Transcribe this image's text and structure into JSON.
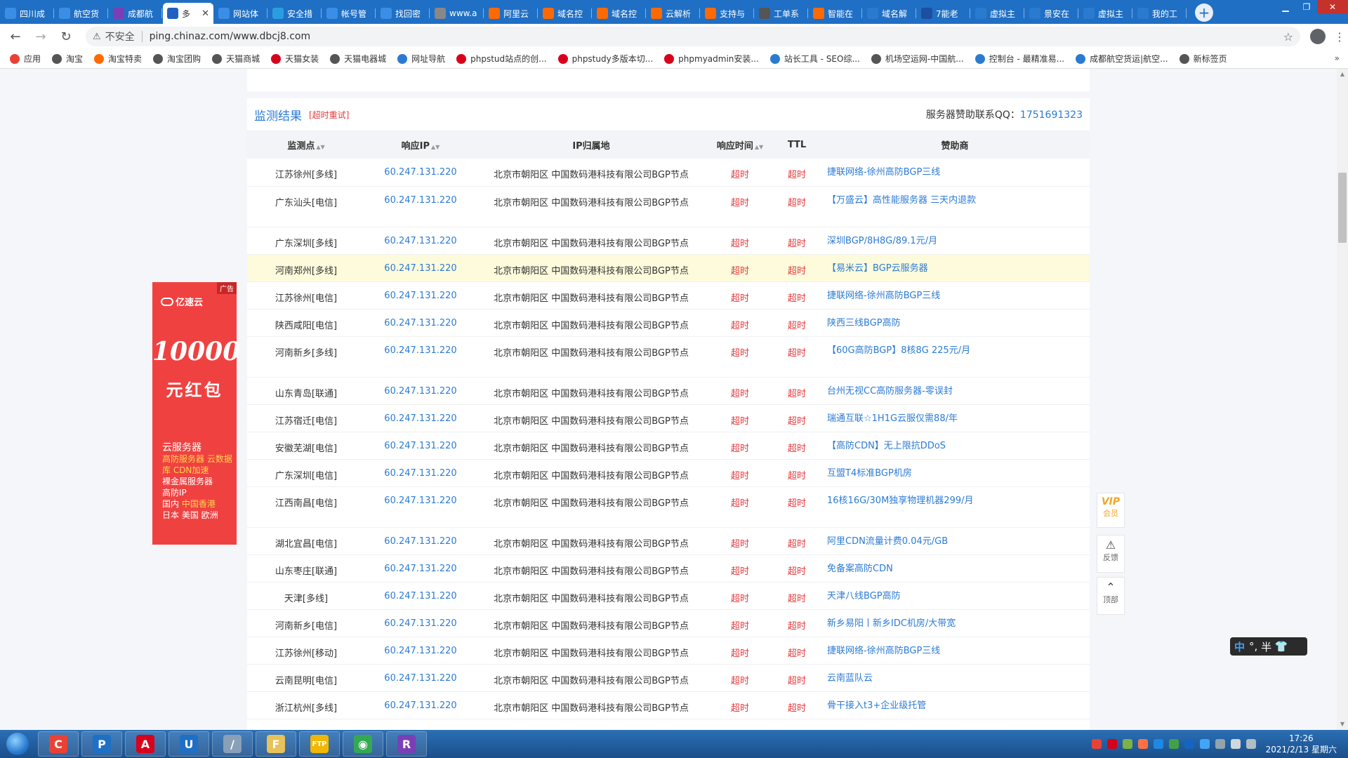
{
  "browser": {
    "tabs": [
      {
        "title": "四川成",
        "color": "#3a8ee6"
      },
      {
        "title": "航空货",
        "color": "#3a8ee6"
      },
      {
        "title": "成都航",
        "color": "#7b3fb5"
      },
      {
        "title": "多",
        "color": "#2060c0",
        "active": true
      },
      {
        "title": "网站体",
        "color": "#3a8ee6"
      },
      {
        "title": "安全措",
        "color": "#2a9de0"
      },
      {
        "title": "帐号管",
        "color": "#3a8ee6"
      },
      {
        "title": "找回密",
        "color": "#3a8ee6"
      },
      {
        "title": "www.a",
        "color": "#888888"
      },
      {
        "title": "阿里云",
        "color": "#ff6a00"
      },
      {
        "title": "域名控",
        "color": "#ff6a00"
      },
      {
        "title": "域名控",
        "color": "#ff6a00"
      },
      {
        "title": "云解析",
        "color": "#ff6a00"
      },
      {
        "title": "支持与",
        "color": "#ff6a00"
      },
      {
        "title": "工单系",
        "color": "#555555"
      },
      {
        "title": "智能在",
        "color": "#ff6a00"
      },
      {
        "title": "域名解",
        "color": "#2a7bd0"
      },
      {
        "title": "7能老",
        "color": "#1c4fa0"
      },
      {
        "title": "虚拟主",
        "color": "#2a7bd0"
      },
      {
        "title": "景安在",
        "color": "#2a7bd0"
      },
      {
        "title": "虚拟主",
        "color": "#2a7bd0"
      },
      {
        "title": "我的工",
        "color": "#2a7bd0"
      }
    ],
    "close_glyph": "✕",
    "new_tab": "+",
    "url_insecure": "不安全",
    "url": "ping.chinaz.com/www.dbcj8.com",
    "bookmarks": [
      {
        "label": "应用",
        "color": "#e94235"
      },
      {
        "label": "淘宝",
        "color": "#555555"
      },
      {
        "label": "淘宝特卖",
        "color": "#ff6a00"
      },
      {
        "label": "淘宝团购",
        "color": "#555555"
      },
      {
        "label": "天猫商城",
        "color": "#555555"
      },
      {
        "label": "天猫女装",
        "color": "#d9001b"
      },
      {
        "label": "天猫电器城",
        "color": "#555555"
      },
      {
        "label": "网址导航",
        "color": "#2a7bd0"
      },
      {
        "label": "phpstud站点的创...",
        "color": "#d9001b"
      },
      {
        "label": "phpstudy多版本切...",
        "color": "#d9001b"
      },
      {
        "label": "phpmyadmin安装...",
        "color": "#d9001b"
      },
      {
        "label": "站长工具 - SEO综...",
        "color": "#2a7bd0"
      },
      {
        "label": "机场空运网-中国航...",
        "color": "#555555"
      },
      {
        "label": "控制台 - 最精准易...",
        "color": "#2a7bd0"
      },
      {
        "label": "成都航空货运|航空...",
        "color": "#2a7bd0"
      },
      {
        "label": "新标签页",
        "color": "#555555"
      }
    ],
    "bookmarks_more": "»"
  },
  "panel": {
    "title": "监测结果",
    "retry": "[超时重试]",
    "sponsor_label": "服务器赞助联系QQ：",
    "sponsor_qq": "1751691323"
  },
  "table": {
    "headers": [
      "监测点",
      "响应IP",
      "IP归属地",
      "响应时间",
      "TTL",
      "赞助商"
    ],
    "rows": [
      {
        "node": "江苏徐州[多线]",
        "ip": "60.247.131.220",
        "loc": "北京市朝阳区 中国数码港科技有限公司BGP节点",
        "time": "超时",
        "ttl": "超时",
        "sponsor": "捷联网络-徐州高防BGP三线",
        "tall": false
      },
      {
        "node": "广东汕头[电信]",
        "ip": "60.247.131.220",
        "loc": "北京市朝阳区 中国数码港科技有限公司BGP节点",
        "time": "超时",
        "ttl": "超时",
        "sponsor": "【万盛云】高性能服务器 三天内退款",
        "tall": true
      },
      {
        "node": "广东深圳[多线]",
        "ip": "60.247.131.220",
        "loc": "北京市朝阳区 中国数码港科技有限公司BGP节点",
        "time": "超时",
        "ttl": "超时",
        "sponsor": "深圳BGP/8H8G/89.1元/月",
        "tall": false
      },
      {
        "node": "河南郑州[多线]",
        "ip": "60.247.131.220",
        "loc": "北京市朝阳区 中国数码港科技有限公司BGP节点",
        "time": "超时",
        "ttl": "超时",
        "sponsor": "【易米云】BGP云服务器",
        "tall": false,
        "highlight": true
      },
      {
        "node": "江苏徐州[电信]",
        "ip": "60.247.131.220",
        "loc": "北京市朝阳区 中国数码港科技有限公司BGP节点",
        "time": "超时",
        "ttl": "超时",
        "sponsor": "捷联网络-徐州高防BGP三线",
        "tall": false
      },
      {
        "node": "陕西咸阳[电信]",
        "ip": "60.247.131.220",
        "loc": "北京市朝阳区 中国数码港科技有限公司BGP节点",
        "time": "超时",
        "ttl": "超时",
        "sponsor": "陕西三线BGP高防",
        "tall": false
      },
      {
        "node": "河南新乡[多线]",
        "ip": "60.247.131.220",
        "loc": "北京市朝阳区 中国数码港科技有限公司BGP节点",
        "time": "超时",
        "ttl": "超时",
        "sponsor": "【60G高防BGP】8核8G 225元/月",
        "tall": true
      },
      {
        "node": "山东青岛[联通]",
        "ip": "60.247.131.220",
        "loc": "北京市朝阳区 中国数码港科技有限公司BGP节点",
        "time": "超时",
        "ttl": "超时",
        "sponsor": "台州无视CC高防服务器-零误封",
        "tall": false
      },
      {
        "node": "江苏宿迁[电信]",
        "ip": "60.247.131.220",
        "loc": "北京市朝阳区 中国数码港科技有限公司BGP节点",
        "time": "超时",
        "ttl": "超时",
        "sponsor": "瑞通互联☆1H1G云服仅需88/年",
        "tall": false
      },
      {
        "node": "安徽芜湖[电信]",
        "ip": "60.247.131.220",
        "loc": "北京市朝阳区 中国数码港科技有限公司BGP节点",
        "time": "超时",
        "ttl": "超时",
        "sponsor": "【高防CDN】无上限抗DDoS",
        "tall": false
      },
      {
        "node": "广东深圳[电信]",
        "ip": "60.247.131.220",
        "loc": "北京市朝阳区 中国数码港科技有限公司BGP节点",
        "time": "超时",
        "ttl": "超时",
        "sponsor": "互盟T4标准BGP机房",
        "tall": false
      },
      {
        "node": "江西南昌[电信]",
        "ip": "60.247.131.220",
        "loc": "北京市朝阳区 中国数码港科技有限公司BGP节点",
        "time": "超时",
        "ttl": "超时",
        "sponsor": "16核16G/30M独享物理机器299/月",
        "tall": true
      },
      {
        "node": "湖北宜昌[电信]",
        "ip": "60.247.131.220",
        "loc": "北京市朝阳区 中国数码港科技有限公司BGP节点",
        "time": "超时",
        "ttl": "超时",
        "sponsor": "阿里CDN流量计费0.04元/GB",
        "tall": false
      },
      {
        "node": "山东枣庄[联通]",
        "ip": "60.247.131.220",
        "loc": "北京市朝阳区 中国数码港科技有限公司BGP节点",
        "time": "超时",
        "ttl": "超时",
        "sponsor": "免备案高防CDN",
        "tall": false
      },
      {
        "node": "天津[多线]",
        "ip": "60.247.131.220",
        "loc": "北京市朝阳区 中国数码港科技有限公司BGP节点",
        "time": "超时",
        "ttl": "超时",
        "sponsor": "天津八线BGP高防",
        "tall": false
      },
      {
        "node": "河南新乡[电信]",
        "ip": "60.247.131.220",
        "loc": "北京市朝阳区 中国数码港科技有限公司BGP节点",
        "time": "超时",
        "ttl": "超时",
        "sponsor": "新乡易阳丨新乡IDC机房/大带宽",
        "tall": false
      },
      {
        "node": "江苏徐州[移动]",
        "ip": "60.247.131.220",
        "loc": "北京市朝阳区 中国数码港科技有限公司BGP节点",
        "time": "超时",
        "ttl": "超时",
        "sponsor": "捷联网络-徐州高防BGP三线",
        "tall": false
      },
      {
        "node": "云南昆明[电信]",
        "ip": "60.247.131.220",
        "loc": "北京市朝阳区 中国数码港科技有限公司BGP节点",
        "time": "超时",
        "ttl": "超时",
        "sponsor": "云南蓝队云",
        "tall": false
      },
      {
        "node": "浙江杭州[多线]",
        "ip": "60.247.131.220",
        "loc": "北京市朝阳区 中国数码港科技有限公司BGP节点",
        "time": "超时",
        "ttl": "超时",
        "sponsor": "骨干接入t3+企业级托管",
        "tall": false
      }
    ]
  },
  "ad": {
    "tag": "广告",
    "brand": "亿速云",
    "headline": "10000",
    "subline": "元红包",
    "line1": "云服务器",
    "line2": "高防服务器 云数据库 CDN加速",
    "line3": "裸金属服务器",
    "line4": "高防IP",
    "line5a": "国内",
    "line5b": "中国香港",
    "line6": "日本 美国 欧洲"
  },
  "float": {
    "vip_title": "VIP",
    "vip_label": "会员",
    "feedback": "反馈",
    "top": "顶部"
  },
  "ime": {
    "lang": "中",
    "punct": "°,",
    "width": "半"
  },
  "taskbar": {
    "apps": [
      {
        "label": "C",
        "color": "#e94235"
      },
      {
        "label": "P",
        "color": "#1f6fc5"
      },
      {
        "label": "A",
        "color": "#d9001b"
      },
      {
        "label": "U",
        "color": "#1f6fc5"
      },
      {
        "label": "/",
        "color": "#8aa0b8"
      },
      {
        "label": "F",
        "color": "#e7c15a"
      },
      {
        "label": "FTP",
        "color": "#f2b705"
      },
      {
        "label": "◉",
        "color": "#34a853"
      },
      {
        "label": "R",
        "color": "#7b3fb5"
      }
    ],
    "time": "17:26",
    "date": "2021/2/13 星期六"
  }
}
